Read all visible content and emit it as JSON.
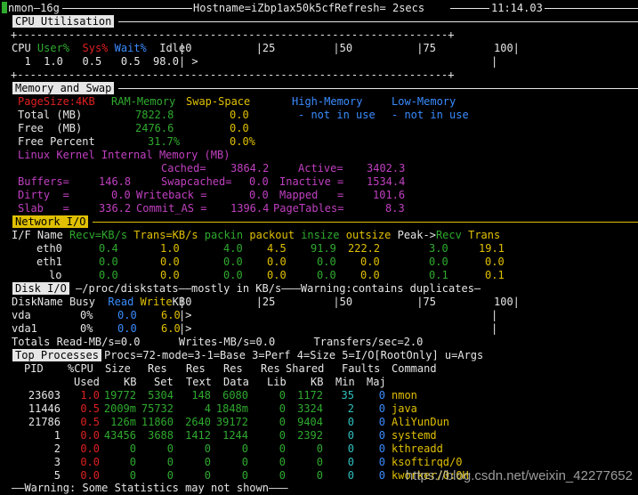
{
  "header": {
    "prog": "nmon—16g",
    "hostname": "Hostname=iZbp1ax50k5cfRefresh= 2secs",
    "time": "11:14.03"
  },
  "cpu": {
    "title": "CPU Utilisation",
    "scale_row": "|0          |25         |50          |75         100|",
    "header_cols": [
      "CPU",
      "User%",
      "Sys%",
      "Wait%",
      "Idle"
    ],
    "row": [
      "1",
      "1.0",
      "0.5",
      "0.5",
      "98.0"
    ],
    "bar": ">",
    "right_bar": "|"
  },
  "memory": {
    "title": "Memory and Swap",
    "pagesize": "PageSize:4KB",
    "col_ram": "RAM-Memory",
    "col_swap": "Swap-Space",
    "col_high": "High-Memory",
    "col_low": "Low-Memory",
    "rows": [
      {
        "label": "Total (MB)",
        "ram": "7822.8",
        "swap": "0.0",
        "high": "- not in use",
        "low": "- not in use"
      },
      {
        "label": "Free  (MB)",
        "ram": "2476.6",
        "swap": "0.0",
        "high": "",
        "low": ""
      },
      {
        "label": "Free Percent",
        "ram": "31.7%",
        "swap": "0.0%",
        "high": "",
        "low": ""
      }
    ],
    "kernel_title": "Linux Kernel Internal Memory (MB)",
    "kernel_rows": [
      [
        "",
        "",
        "Cached=",
        "3864.2",
        "Active=",
        "3402.3"
      ],
      [
        "Buffers=",
        "146.8",
        "Swapcached=",
        "0.0",
        "Inactive =",
        "1534.4"
      ],
      [
        "Dirty  =",
        "0.0",
        "Writeback =",
        "0.0",
        "Mapped   =",
        "101.6"
      ],
      [
        "Slab   =",
        "336.2",
        "Commit_AS =",
        "1396.4",
        "PageTables=",
        "8.3"
      ]
    ]
  },
  "network": {
    "title": "Network I/O",
    "header": {
      "ifname": "I/F Name",
      "recv": "Recv=KB/s",
      "trans": "Trans=KB/s",
      "packin": "packin",
      "packout": "packout",
      "insize": "insize",
      "outsize": "outsize",
      "peak": "Peak->",
      "recv2": "Recv",
      "trans2": "Trans"
    },
    "rows": [
      [
        "eth0",
        "0.4",
        "1.0",
        "4.0",
        "4.5",
        "91.9",
        "222.2",
        "3.0",
        "19.1"
      ],
      [
        "eth1",
        "0.0",
        "0.0",
        "0.0",
        "0.0",
        "0.0",
        "0.0",
        "0.0",
        "0.0"
      ],
      [
        "lo",
        "0.0",
        "0.0",
        "0.0",
        "0.0",
        "0.0",
        "0.0",
        "0.1",
        "0.1"
      ]
    ]
  },
  "disk": {
    "title": "Disk I/O",
    "subtitle": "—/proc/diskstats——mostly in KB/s———Warning:contains duplicates—",
    "header": {
      "name": "DiskName",
      "busy": "Busy",
      "read": "Read",
      "write": "Write",
      "unit": "KB"
    },
    "scale_row": "|0          |25         |50          |75         100|",
    "rows": [
      [
        "vda",
        "0%",
        "0.0",
        "6.0",
        "|>"
      ],
      [
        "vda1",
        "0%",
        "0.0",
        "6.0",
        "|>"
      ]
    ],
    "totals": "Totals Read-MB/s=0.0      Writes-MB/s=0.0      Transfers/sec=2.0"
  },
  "top": {
    "title": "Top Processes",
    "subtitle": "Procs=72-mode=3-1=Base 3=Perf 4=Size 5=I/O[RootOnly] u=Args",
    "headers1": [
      "PID",
      "%CPU",
      "Size",
      "Res",
      "Res",
      "Res",
      "Res",
      "Shared",
      "Faults",
      "Command"
    ],
    "headers2": [
      "",
      "Used",
      "KB",
      "Set",
      "Text",
      "Data",
      "Lib",
      "KB",
      "Min",
      "Maj",
      ""
    ],
    "rows": [
      [
        "23603",
        "1.0",
        "19772",
        "5304",
        "148",
        "6080",
        "0",
        "1172",
        "35",
        "0",
        "nmon"
      ],
      [
        "11446",
        "0.5",
        "2009m",
        "75732",
        "4",
        "1848m",
        "0",
        "3324",
        "2",
        "0",
        "java"
      ],
      [
        "21786",
        "0.5",
        "126m",
        "11860",
        "2640",
        "39172",
        "0",
        "9404",
        "0",
        "0",
        "AliYunDun"
      ],
      [
        "1",
        "0.0",
        "43456",
        "3688",
        "1412",
        "1244",
        "0",
        "2392",
        "0",
        "0",
        "systemd"
      ],
      [
        "2",
        "0.0",
        "0",
        "0",
        "0",
        "0",
        "0",
        "0",
        "0",
        "0",
        "kthreadd"
      ],
      [
        "3",
        "0.0",
        "0",
        "0",
        "0",
        "0",
        "0",
        "0",
        "0",
        "0",
        "ksoftirqd/0"
      ],
      [
        "5",
        "0.0",
        "0",
        "0",
        "0",
        "0",
        "0",
        "0",
        "0",
        "0",
        "kworker/0:0H"
      ]
    ]
  },
  "footer": "——Warning: Some Statistics may not shown———",
  "watermark": "https://blog.csdn.net/weixin_42277652"
}
